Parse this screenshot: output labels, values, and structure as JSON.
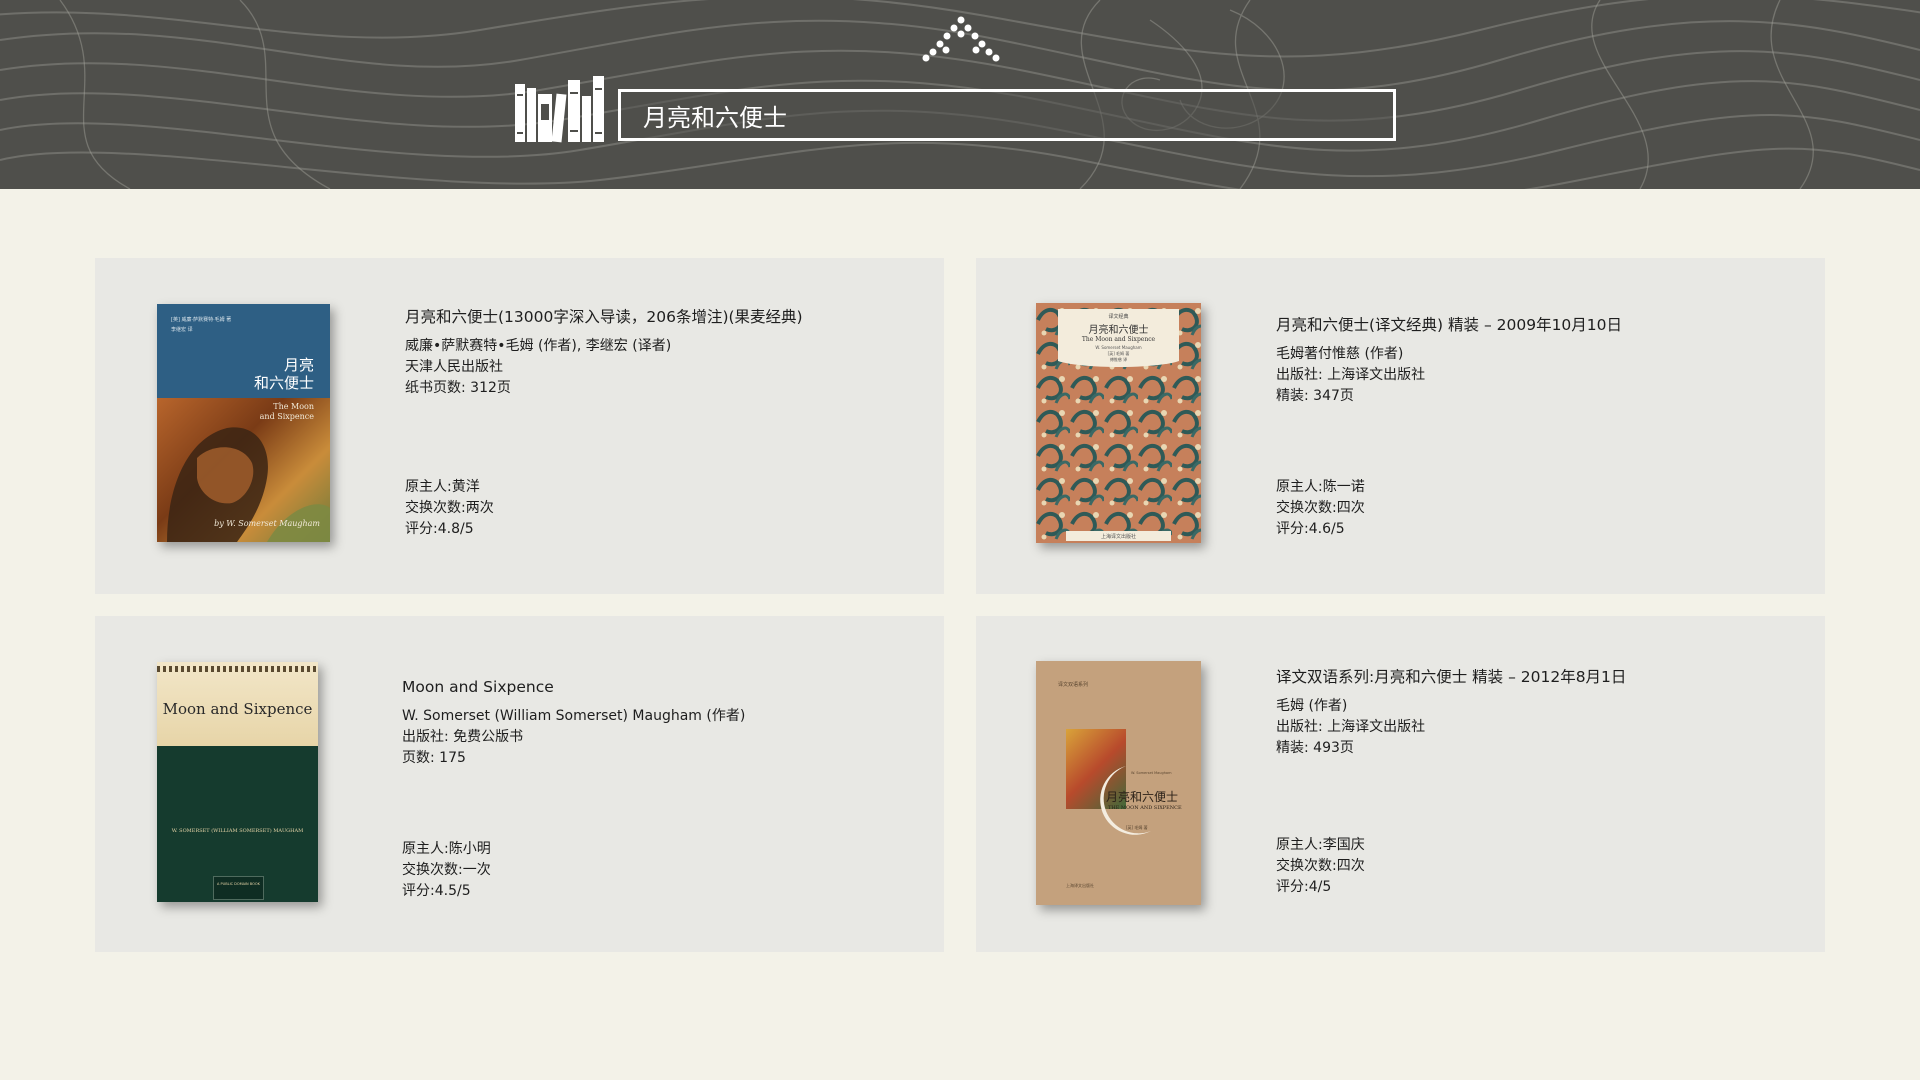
{
  "search": {
    "query": "月亮和六便士"
  },
  "books": [
    {
      "title": "月亮和六便士(13000字深入导读，206条增注)(果麦经典)",
      "author": "威廉•萨默赛特•毛姆 (作者), 李继宏 (译者)",
      "publisher": "天津人民出版社",
      "pages": "纸书页数: 312页",
      "owner": "原主人:黄洋",
      "exchanges": "交换次数:两次",
      "rating": "评分:4.8/5",
      "cover": {
        "top_small": "[英] 威廉·萨默赛特·毛姆 著",
        "translator": "李继宏 译",
        "title_cn_1": "月亮",
        "title_cn_2": "和六便士",
        "title_en_1": "The Moon",
        "title_en_2": "and Sixpence",
        "author_en": "by W. Somerset Maugham"
      }
    },
    {
      "title": "月亮和六便士(译文经典) 精装 – 2009年10月10日",
      "author": "毛姆著付惟慈 (作者)",
      "publisher": "出版社: 上海译文出版社",
      "pages": "精装: 347页",
      "owner": "原主人:陈一诺",
      "exchanges": "交换次数:四次",
      "rating": "评分:4.6/5",
      "cover": {
        "series": "译文经典",
        "title_cn": "月亮和六便士",
        "title_en": "The Moon and Sixpence",
        "author_en": "W. Somerset Maugham",
        "author_cn": "[英] 毛姆 著",
        "translator": "傅惟慈 译",
        "publisher": "上海译文出版社"
      }
    },
    {
      "title": "Moon and Sixpence",
      "author": "W. Somerset (William Somerset) Maugham (作者)",
      "publisher": "出版社: 免费公版书",
      "pages": "页数: 175",
      "owner": "原主人:陈小明",
      "exchanges": "交换次数:一次",
      "rating": "评分:4.5/5",
      "cover": {
        "title_en": "Moon and Sixpence",
        "author_en": "W. SOMERSET (WILLIAM SOMERSET) MAUGHAM",
        "badge": "A PUBLIC DOMAIN BOOK"
      }
    },
    {
      "title": "译文双语系列:月亮和六便士 精装 – 2012年8月1日",
      "author": "毛姆 (作者)",
      "publisher": "出版社: 上海译文出版社",
      "pages": "精装: 493页",
      "owner": "原主人:李国庆",
      "exchanges": "交换次数:四次",
      "rating": "评分:4/5",
      "cover": {
        "series": "译文双语系列",
        "title_cn": "月亮和六便士",
        "title_en": "THE MOON AND SIXPENCE",
        "author_en": "W. Somerset Maugham",
        "author_cn": "[英] 毛姆 著",
        "publisher": "上海译文出版社"
      }
    }
  ],
  "colors": {
    "header_bg": "#4f4f4b",
    "page_bg": "#f3f2e8",
    "card_bg": "#e8e8e4"
  }
}
